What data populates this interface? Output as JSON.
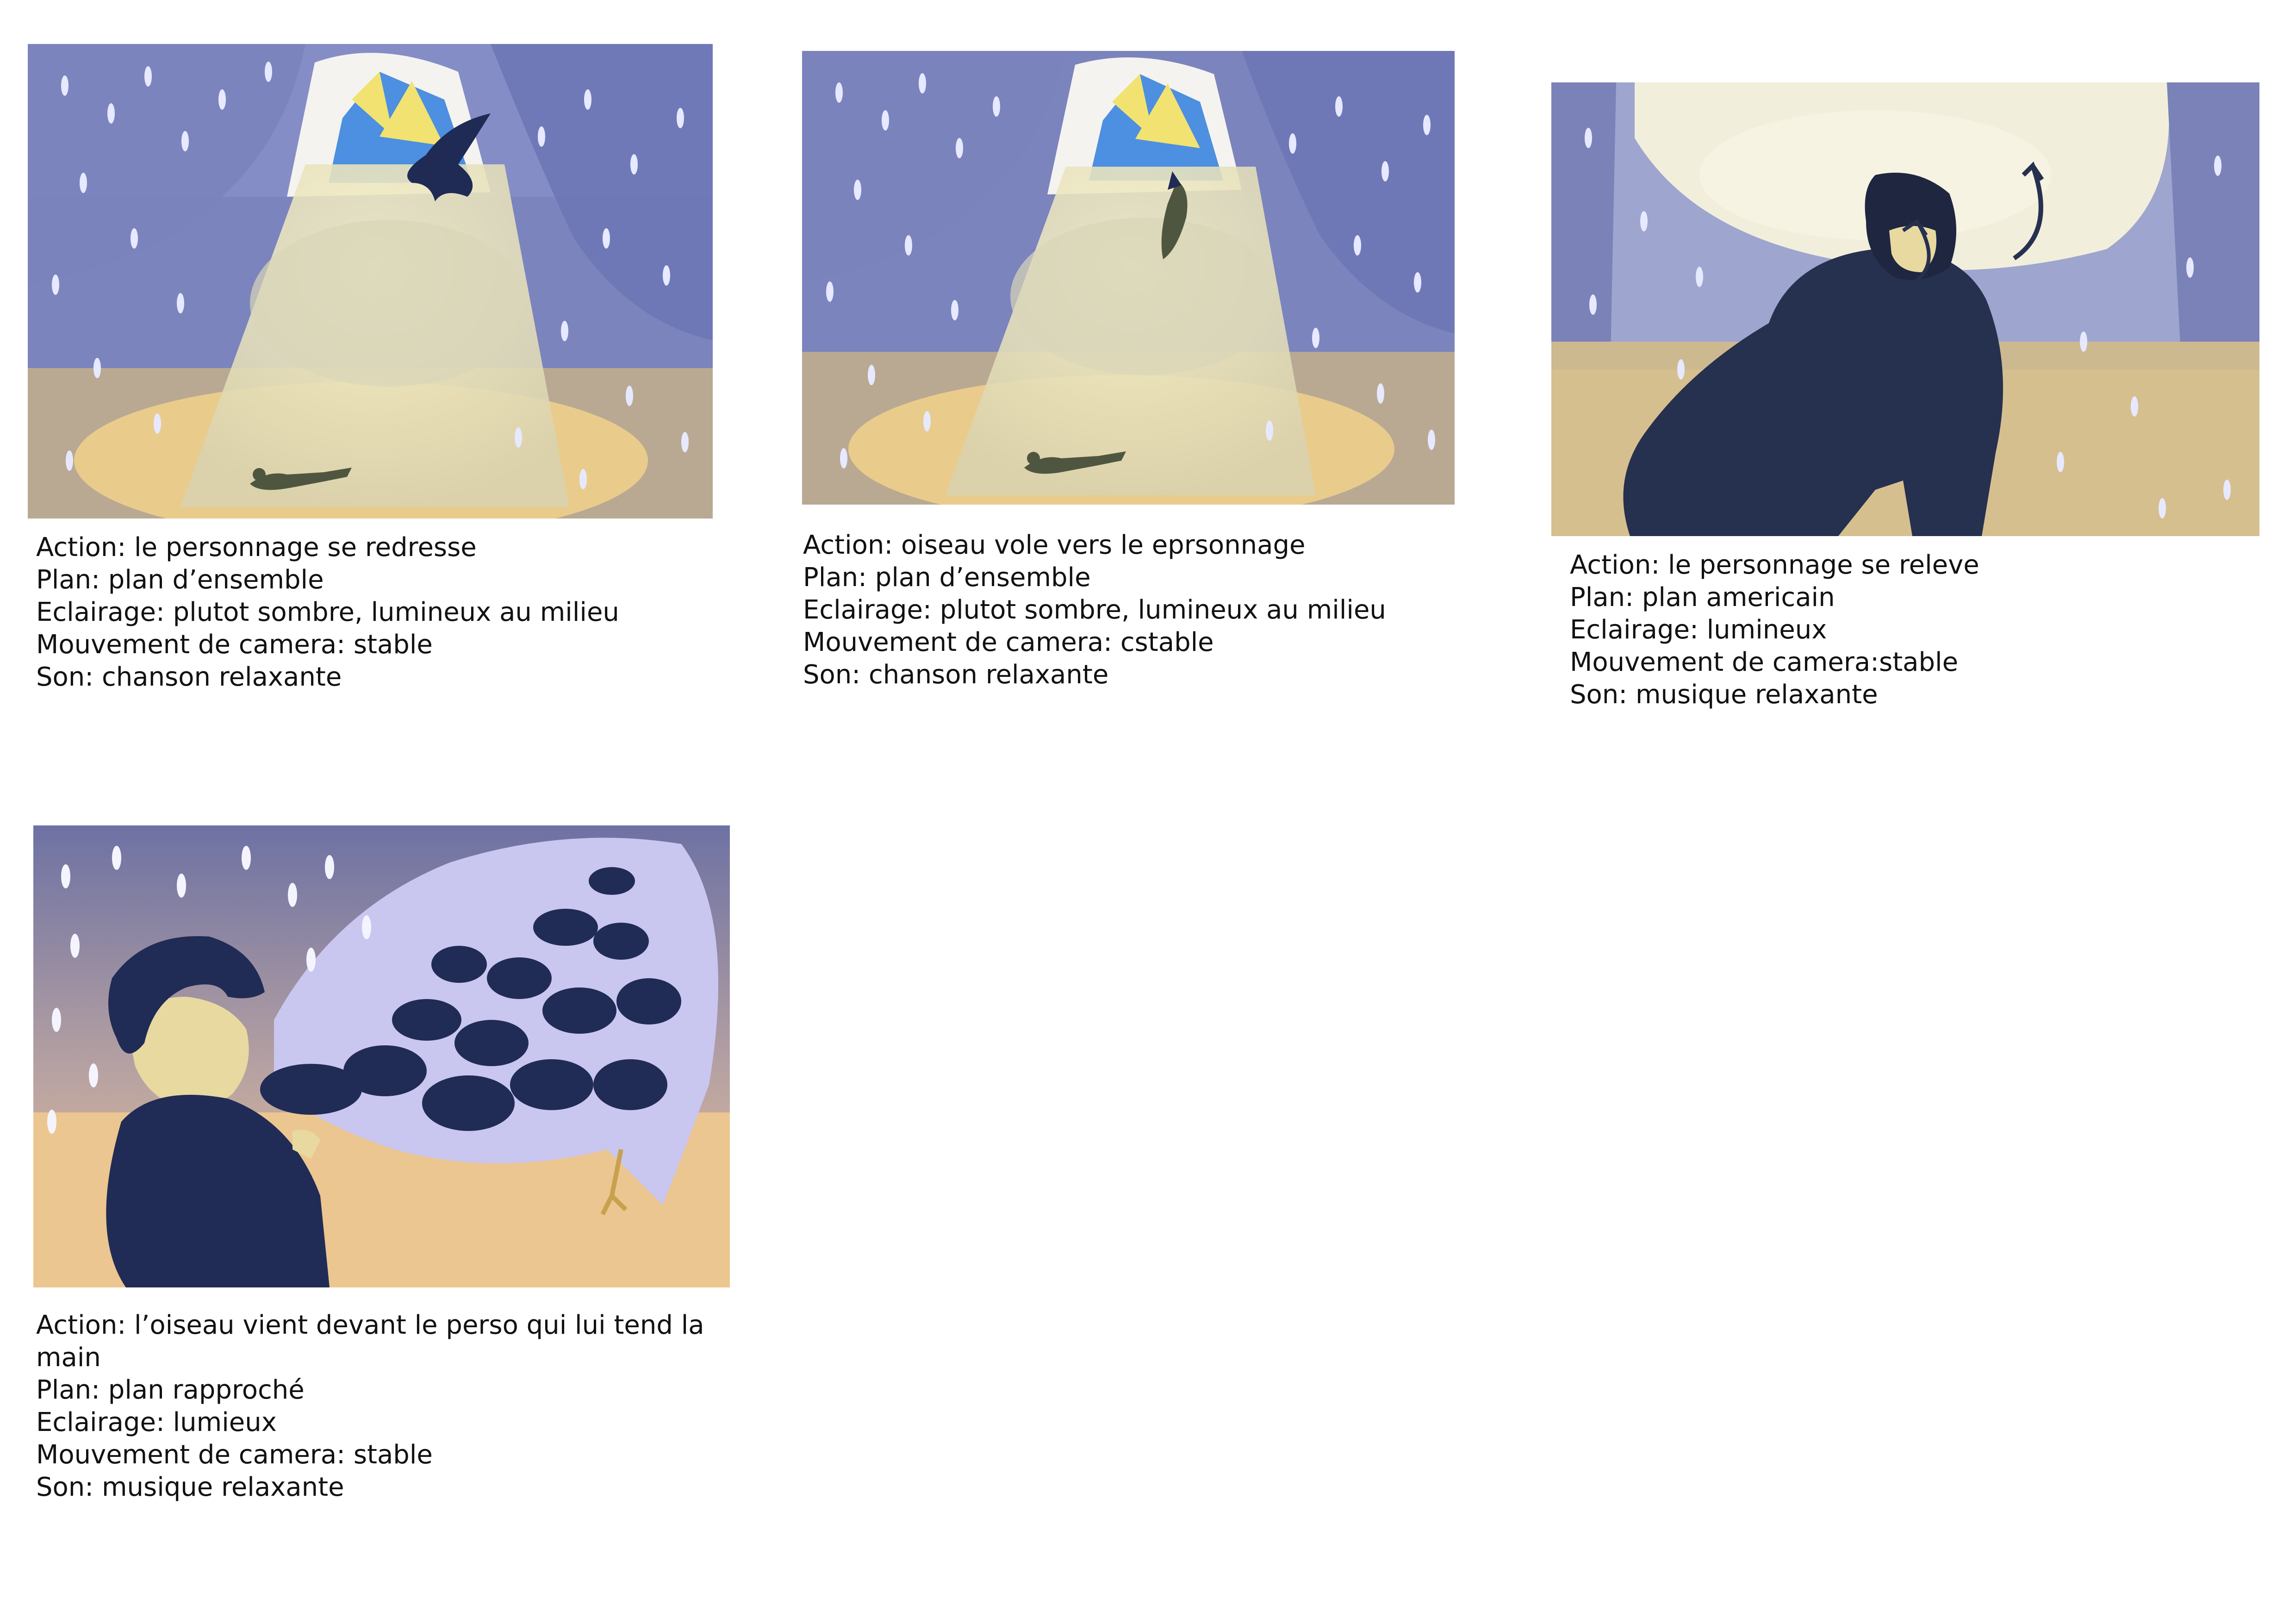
{
  "panels": [
    {
      "id": 1,
      "lines": [
        "Action: le personnage se redresse",
        "Plan: plan d’ensemble",
        "Eclairage: plutot sombre, lumineux au milieu",
        "Mouvement de camera: stable",
        "Son: chanson relaxante"
      ]
    },
    {
      "id": 2,
      "lines": [
        "Action: oiseau vole  vers le eprsonnage",
        "Plan: plan d’ensemble",
        "Eclairage: plutot sombre, lumineux au milieu",
        "Mouvement de camera: cstable",
        "Son: chanson relaxante"
      ]
    },
    {
      "id": 3,
      "lines": [
        "Action: le personnage se releve",
        "Plan: plan americain",
        "Eclairage: lumineux",
        "Mouvement de camera:stable",
        "Son: musique relaxante"
      ]
    },
    {
      "id": 4,
      "lines": [
        "Action: l’oiseau vient devant le perso qui lui tend la main",
        "Plan: plan rapproché",
        "Eclairage: lumieux",
        "Mouvement de camera: stable",
        "Son: musique relaxante"
      ]
    }
  ],
  "colors": {
    "storm_blue": "#7f86bd",
    "storm_dark": "#59629c",
    "light_beam": "#eee8b8",
    "sand": "#e8c98b",
    "sky": "#4a8fe0",
    "sun_yellow": "#f2e26a",
    "navy": "#202c55",
    "skin": "#e8d9a0",
    "wing_lilac": "#c9c6ef"
  }
}
